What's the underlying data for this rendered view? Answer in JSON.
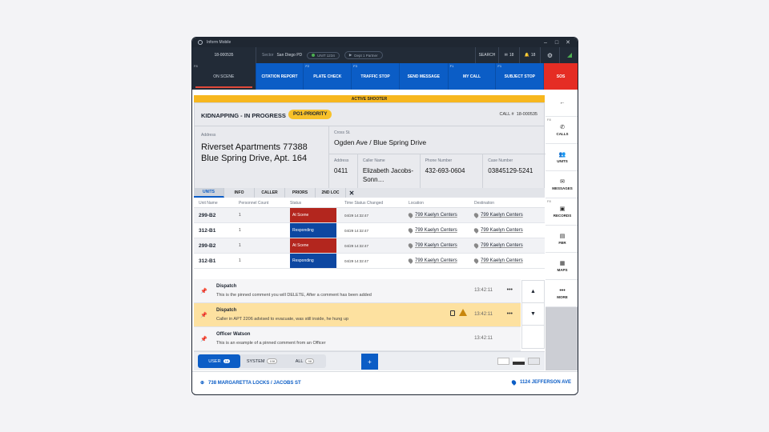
{
  "app": {
    "title": "Inform Mobile"
  },
  "window_controls": {
    "minimize": "–",
    "maximize": "□",
    "close": "✕"
  },
  "topbar": {
    "unit_id": "18-000535",
    "sector_label": "Sector",
    "sector_value": "San Diego PD",
    "pill1": "UNIT 1234",
    "pill2": "Dept 1 Partner",
    "search": "SEARCH",
    "mail_count": "18",
    "alert_count": "18"
  },
  "fkeys": [
    {
      "fn": "F8",
      "label": "ON SCENE"
    },
    {
      "fn": "",
      "label": "CITATION REPORT"
    },
    {
      "fn": "F2",
      "label": "PLATE CHECK"
    },
    {
      "fn": "F3",
      "label": "TRAFFIC STOP"
    },
    {
      "fn": "",
      "label": "SEND MESSAGE"
    },
    {
      "fn": "F1",
      "label": "MY CALL"
    },
    {
      "fn": "F1",
      "label": "SUBJECT STOP"
    },
    {
      "fn": "",
      "label": "SOS"
    }
  ],
  "banner": "ACTIVE SHOOTER",
  "incident": {
    "title": "KIDNAPPING - IN PROGRESS",
    "priority": "PO1-PRIORITY",
    "call_label": "CALL #",
    "call_no": "18-000535",
    "address_label": "Address",
    "address": "Riverset Apartments 77388 Blue Spring Drive, Apt. 164",
    "cross_label": "Cross St.",
    "cross": "Ogden Ave / Blue Spring Drive",
    "f_address_label": "Address",
    "f_address": "0411",
    "caller_label": "Caller Name",
    "caller": "Elizabeth Jacobs-Sonn…",
    "phone_label": "Phone Number",
    "phone": "432-693-0604",
    "case_label": "Case Number",
    "case": "03845129-5241"
  },
  "tabs": [
    "UNITS",
    "INFO",
    "CALLER",
    "PRIORS",
    "2ND LOC"
  ],
  "tabs_close": "✕",
  "units": {
    "headers": [
      "Unit Name",
      "Personnel Count",
      "Status",
      "Time Status Changed",
      "Location",
      "Destination"
    ],
    "rows": [
      {
        "unit": "299-B2",
        "count": "1",
        "status": "At Scene",
        "time": "04/29 14:32:47",
        "location": "799 Kaelyn Centers",
        "dest": "799 Kaelyn Centers"
      },
      {
        "unit": "312-B1",
        "count": "1",
        "status": "Responding",
        "time": "04/29 14:32:47",
        "location": "799 Kaelyn Centers",
        "dest": "799 Kaelyn Centers"
      },
      {
        "unit": "299-B2",
        "count": "1",
        "status": "At Scene",
        "time": "04/29 14:32:47",
        "location": "799 Kaelyn Centers",
        "dest": "799 Kaelyn Centers"
      },
      {
        "unit": "312-B1",
        "count": "1",
        "status": "Responding",
        "time": "04/29 14:32:47",
        "location": "799 Kaelyn Centers",
        "dest": "799 Kaelyn Centers"
      }
    ],
    "status_colors": {
      "At Scene": "#b3261e",
      "Responding": "#0d47a1"
    }
  },
  "comments": [
    {
      "who": "Dispatch",
      "text": "This is the pinned comment you will DELETE, After a comment has been added",
      "time": "13:42:11",
      "more": "•••"
    },
    {
      "who": "Dispatch",
      "text": "Caller in APT 2206 advised to evacuate, was still inside, he hung up",
      "time": "13:42:11",
      "more": "•••"
    },
    {
      "who": "Officer Watson",
      "text": "This is an example of a pinned comment from an Officer",
      "time": "13:42:11",
      "more": "•••"
    }
  ],
  "scroll": {
    "up": "▲",
    "down": "▼"
  },
  "filters": {
    "user": "USER",
    "user_count": "18",
    "system": "SYSTEM",
    "system_count": "108",
    "all": "ALL",
    "all_count": "98",
    "add": "+"
  },
  "sidebar": [
    {
      "fn": "",
      "icon": "←",
      "label": ""
    },
    {
      "fn": "F8",
      "icon": "✆",
      "label": "CALLS"
    },
    {
      "fn": "",
      "icon": "👥",
      "label": "UNITS"
    },
    {
      "fn": "",
      "icon": "✉",
      "label": "MESSAGES"
    },
    {
      "fn": "F8",
      "icon": "▣",
      "label": "RECORDS"
    },
    {
      "fn": "",
      "icon": "▤",
      "label": "FBR"
    },
    {
      "fn": "",
      "icon": "▦",
      "label": "MAPS"
    },
    {
      "fn": "",
      "icon": "•••",
      "label": "MORE"
    }
  ],
  "footer": {
    "left": "738 MARGARETTA LOCKS / JACOBS ST",
    "right": "1124 JEFFERSON AVE"
  },
  "colors": {
    "accent": "#0b5dc6",
    "sos": "#e52d24",
    "banner": "#f7b71e",
    "highlight": "#fde1a0"
  }
}
